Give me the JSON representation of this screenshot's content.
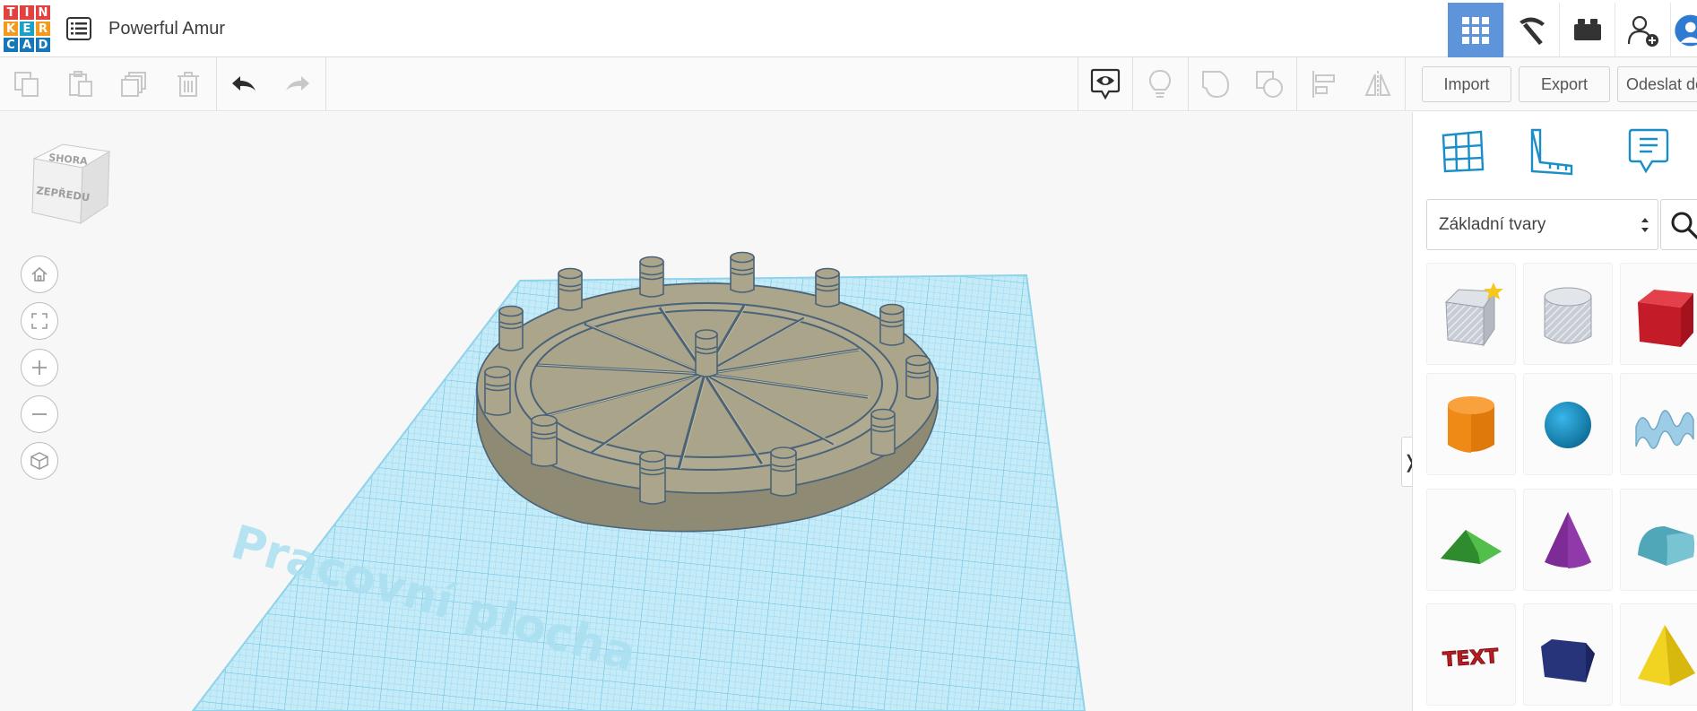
{
  "app": {
    "logo_letters": [
      "T",
      "I",
      "N",
      "K",
      "E",
      "R",
      "C",
      "A",
      "D"
    ],
    "logo_colors": [
      "#e2423f",
      "#e2423f",
      "#e2423f",
      "#f39a1e",
      "#19a1c7",
      "#f39a1e",
      "#1478b8",
      "#1478b8",
      "#1478b8"
    ],
    "document_title": "Powerful Amur"
  },
  "topbar": {
    "icons": [
      "3d-design-grid-icon",
      "codeblocks-pickaxe-icon",
      "bricks-icon",
      "invite-user-icon",
      "user-avatar"
    ]
  },
  "toolbar": {
    "edit_icons": [
      "copy-icon",
      "paste-icon",
      "duplicate-icon",
      "delete-icon",
      "undo-icon",
      "redo-icon"
    ],
    "view_icons": [
      "notes-visibility-icon",
      "light-bulb-icon",
      "group-icon",
      "ungroup-icon",
      "align-icon",
      "mirror-icon"
    ],
    "import_label": "Import",
    "export_label": "Export",
    "send_label": "Odeslat do"
  },
  "workplane": {
    "navcube_top_label": "SHORA",
    "navcube_front_label": "ZEPŘEDU",
    "plane_label": "Pracovní plocha",
    "nav_controls": [
      "home-view",
      "fit-all",
      "zoom-in",
      "zoom-out",
      "perspective-toggle"
    ],
    "collapse_glyph": "❭",
    "colors": {
      "grid": "#8fd3ea",
      "plane": "#c4ebf7",
      "model": "#aba58b",
      "model_edge": "#4a6378"
    }
  },
  "panel": {
    "icons": [
      "workplane-icon",
      "ruler-icon",
      "notes-icon"
    ],
    "category_select": "Základní tvary",
    "shapes": [
      "box-hole",
      "cylinder-hole",
      "box",
      "cylinder",
      "sphere",
      "scribble",
      "roof",
      "cone",
      "round-roof",
      "text",
      "wedge",
      "pyramid"
    ],
    "text_shape_label": "TEXT"
  }
}
